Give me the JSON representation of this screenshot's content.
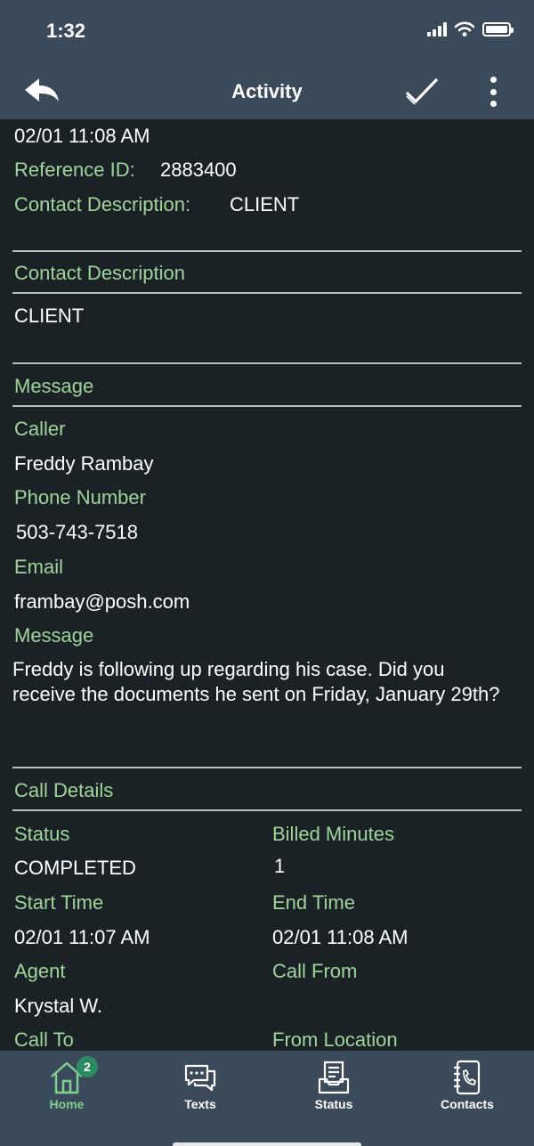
{
  "status_bar": {
    "time": "1:32"
  },
  "nav": {
    "title": "Activity"
  },
  "summary": {
    "datetime": "02/01 11:08 AM",
    "reference_label": "Reference ID:",
    "reference_value": "2883400",
    "contact_desc_label": "Contact Description:",
    "contact_desc_value": "CLIENT"
  },
  "contact_section": {
    "header": "Contact Description",
    "value": "CLIENT"
  },
  "message_section": {
    "header": "Message",
    "caller_label": "Caller",
    "caller_value": "Freddy Rambay",
    "phone_label": "Phone Number",
    "phone_value": "503-743-7518",
    "email_label": "Email",
    "email_value": "frambay@posh.com",
    "message_label": "Message",
    "message_value": "Freddy is following up regarding his case. Did you receive the documents he sent on Friday, January 29th?"
  },
  "call_details": {
    "header": "Call Details",
    "status_label": "Status",
    "status_value": "COMPLETED",
    "billed_label": "Billed Minutes",
    "billed_value": "1",
    "start_label": "Start Time",
    "start_value": "02/01 11:07 AM",
    "end_label": "End Time",
    "end_value": "02/01 11:08 AM",
    "agent_label": "Agent",
    "agent_value": "Krystal W.",
    "call_from_label": "Call From",
    "call_to_label": "Call To",
    "from_location_label": "From Location"
  },
  "tabs": [
    {
      "label": "Home",
      "icon": "home-icon",
      "badge": "2"
    },
    {
      "label": "Texts",
      "icon": "chat-icon"
    },
    {
      "label": "Status",
      "icon": "inbox-icon"
    },
    {
      "label": "Contacts",
      "icon": "contacts-book-icon"
    }
  ],
  "colors": {
    "bar": "#3a4a5a",
    "background": "#1b2226",
    "label": "#9fd49b",
    "active_tab": "#7fcf8f",
    "badge": "#2c8a62"
  }
}
